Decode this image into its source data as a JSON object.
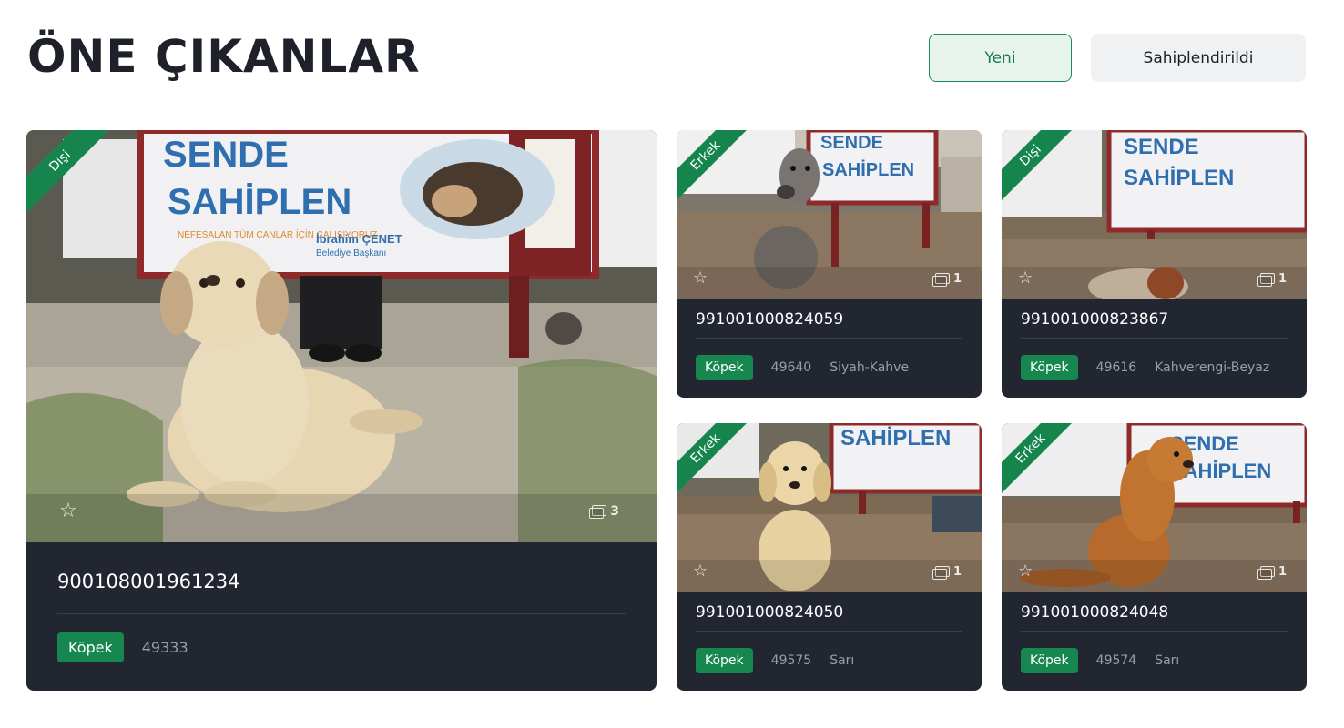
{
  "header": {
    "title": "ÖNE ÇIKANLAR",
    "tabs": [
      {
        "label": "Yeni",
        "active": true
      },
      {
        "label": "Sahiplendirildi",
        "active": false
      }
    ]
  },
  "colors": {
    "accent_green": "#15854d",
    "card_bg": "#222630",
    "muted_text": "#9a9ea8"
  },
  "cards": [
    {
      "gender": "Dişi",
      "chip": "900108001961234",
      "species": "Köpek",
      "id": "49333",
      "color": "",
      "photos": "3",
      "dog_color": "#e8d6b2"
    },
    {
      "gender": "Erkek",
      "chip": "991001000824059",
      "species": "Köpek",
      "id": "49640",
      "color": "Siyah-Kahve",
      "photos": "1",
      "dog_color": "#6b6661"
    },
    {
      "gender": "Dişi",
      "chip": "991001000823867",
      "species": "Köpek",
      "id": "49616",
      "color": "Kahverengi-Beyaz",
      "photos": "1",
      "dog_color": "#d9c7b0"
    },
    {
      "gender": "Erkek",
      "chip": "991001000824050",
      "species": "Köpek",
      "id": "49575",
      "color": "Sarı",
      "photos": "1",
      "dog_color": "#e9d2a1"
    },
    {
      "gender": "Erkek",
      "chip": "991001000824048",
      "species": "Köpek",
      "id": "49574",
      "color": "Sarı",
      "photos": "1",
      "dog_color": "#b86a2c"
    }
  ],
  "banner": {
    "line1": "SENDE",
    "line2": "SAHİPLEN",
    "slogan": "NEFESALAN TÜM CANLAR İÇİN ÇALIŞIYORUZ",
    "mayor": "İbrahim ÇENET",
    "mayor_title": "Belediye Başkanı"
  },
  "icons": {
    "favorite": "star-icon",
    "gallery": "gallery-icon"
  }
}
